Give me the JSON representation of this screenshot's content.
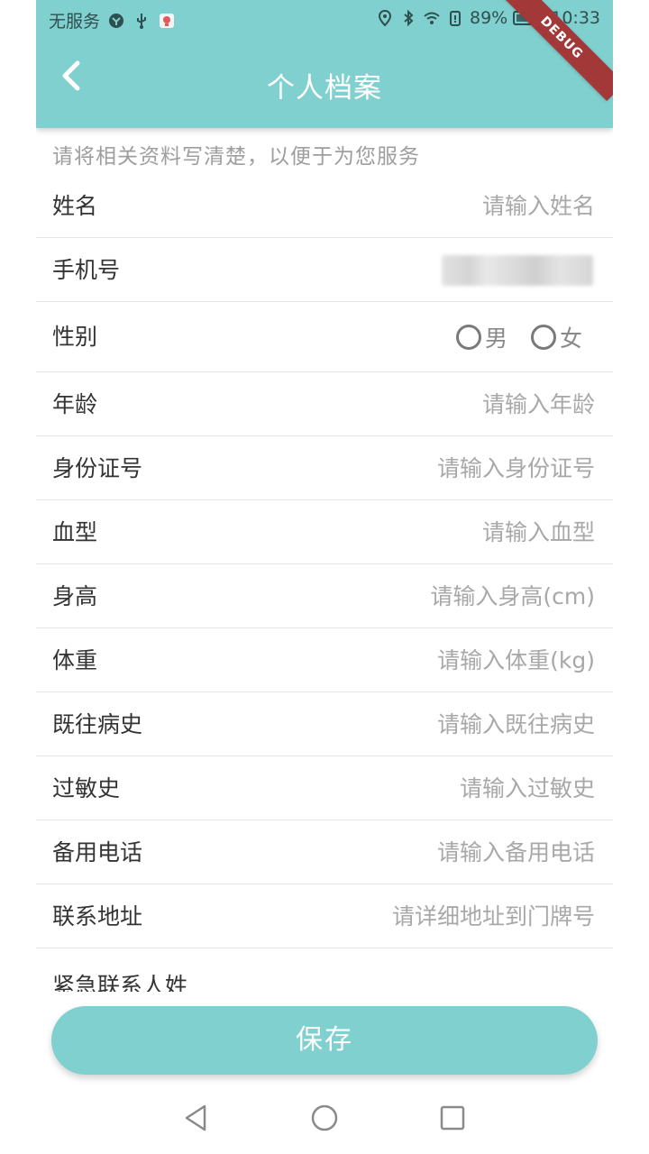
{
  "status_bar": {
    "carrier": "无服务",
    "battery_percent": "89%",
    "time": "10:33"
  },
  "header": {
    "title": "个人档案",
    "debug_banner": "DEBUG"
  },
  "intro_text": "请将相关资料写清楚，以便于为您服务",
  "form": {
    "name": {
      "label": "姓名",
      "placeholder": "请输入姓名"
    },
    "phone": {
      "label": "手机号"
    },
    "gender": {
      "label": "性别",
      "option_male": "男",
      "option_female": "女"
    },
    "age": {
      "label": "年龄",
      "placeholder": "请输入年龄"
    },
    "id_number": {
      "label": "身份证号",
      "placeholder": "请输入身份证号"
    },
    "blood_type": {
      "label": "血型",
      "placeholder": "请输入血型"
    },
    "height": {
      "label": "身高",
      "placeholder": "请输入身高(cm)"
    },
    "weight": {
      "label": "体重",
      "placeholder": "请输入体重(kg)"
    },
    "medical_history": {
      "label": "既往病史",
      "placeholder": "请输入既往病史"
    },
    "allergy_history": {
      "label": "过敏史",
      "placeholder": "请输入过敏史"
    },
    "backup_phone": {
      "label": "备用电话",
      "placeholder": "请输入备用电话"
    },
    "address": {
      "label": "联系地址",
      "placeholder": "请详细地址到门牌号"
    },
    "emergency_contact": {
      "label": "紧急联系人姓"
    }
  },
  "save_label": "保存",
  "colors": {
    "accent": "#80d0cf",
    "debug": "#a33838"
  },
  "icons": {
    "back": "chevron-left-icon",
    "nav_back": "triangle-back-icon",
    "nav_home": "circle-home-icon",
    "nav_recent": "square-recent-icon"
  }
}
